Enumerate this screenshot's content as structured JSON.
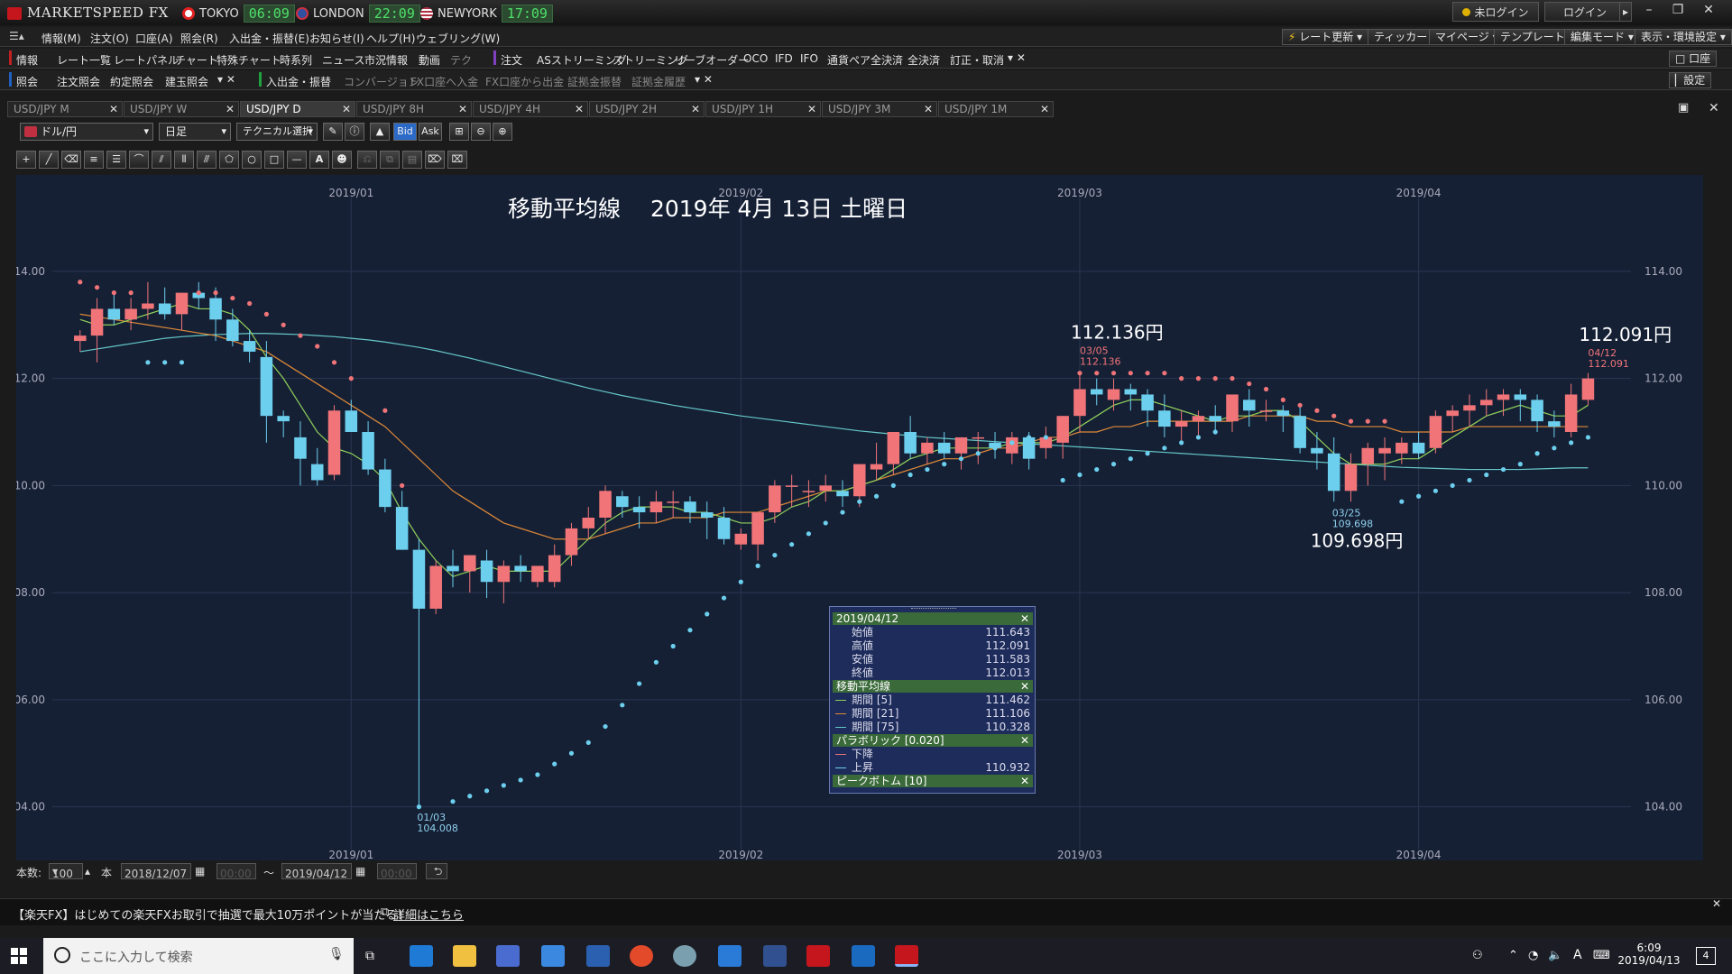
{
  "app": {
    "title": "MARKETSPEED FX",
    "clocks": [
      {
        "city": "TOKYO",
        "time": "06:09",
        "flag_color": "#e02020"
      },
      {
        "city": "LONDON",
        "time": "22:09",
        "flag_color": "#3050a0"
      },
      {
        "city": "NEWYORK",
        "time": "17:09",
        "flag_color": "#b03040"
      }
    ],
    "status_label": "未ログイン",
    "login_label": "ログイン"
  },
  "menu": {
    "items": [
      "情報(M)",
      "注文(O)",
      "口座(A)",
      "照会(R)",
      "入出金・振替(E)",
      "お知らせ(I)",
      "ヘルプ(H)",
      "ウェブリング(W)"
    ],
    "right_buttons": [
      "レート更新",
      "ティッカー",
      "マイページ",
      "テンプレート",
      "編集モード",
      "表示・環境設定"
    ]
  },
  "toolbar1": {
    "info_label": "情報",
    "items": [
      "レート一覧",
      "レートパネル",
      "チャート",
      "特殊チャート",
      "時系列",
      "ニュース",
      "市況情報",
      "動画",
      "テク"
    ],
    "order_label": "注文",
    "order_items": [
      "ASストリーミング",
      "ストリーミング",
      "リーブオーダー",
      "OCO",
      "IFD",
      "IFO",
      "通貨ペア全決済",
      "全決済",
      "訂正・取消"
    ],
    "right_label": "口座"
  },
  "toolbar2": {
    "inquiry_label": "照会",
    "items": [
      "注文照会",
      "約定照会",
      "建玉照会"
    ],
    "deposit_label": "入出金・振替",
    "items2": [
      "コンバージョン",
      "FX口座へ入金",
      "FX口座から出金",
      "証拠金振替",
      "証拠金履歴"
    ],
    "right_label": "設定"
  },
  "tabs": [
    "USD/JPY M",
    "USD/JPY W",
    "USD/JPY D",
    "USD/JPY 8H",
    "USD/JPY 4H",
    "USD/JPY 2H",
    "USD/JPY 1H",
    "USD/JPY 3M",
    "USD/JPY 1M"
  ],
  "active_tab": 2,
  "chart_toolbar": {
    "pair": "ドル/円",
    "period": "日足",
    "technical": "テクニカル選択",
    "bid": "Bid",
    "ask": "Ask"
  },
  "chart_data": {
    "type": "candlestick",
    "title": "移動平均線　 2019年 4月 13日 土曜日",
    "ylim": [
      103.0,
      115.8
    ],
    "yticks": [
      "114.00",
      "112.00",
      "110.00",
      "108.00",
      "106.00",
      "104.00"
    ],
    "x_labels_top": [
      "2019/01",
      "2019/02",
      "2019/03",
      "2019/04"
    ],
    "x_labels_bottom": [
      "2019/01",
      "2019/02",
      "2019/03",
      "2019/04"
    ],
    "annotations": {
      "high1": {
        "big": "112.136円",
        "date": "03/05",
        "value": "112.136"
      },
      "high2": {
        "big": "112.091円",
        "date": "04/12",
        "value": "112.091"
      },
      "low1": {
        "big": "109.698円",
        "date": "03/25",
        "value": "109.698"
      },
      "low2": {
        "date": "01/03",
        "value": "104.008"
      }
    },
    "candles": [
      [
        112.7,
        112.9,
        112.5,
        112.8
      ],
      [
        112.8,
        113.5,
        112.3,
        113.3
      ],
      [
        113.3,
        113.6,
        113.0,
        113.1
      ],
      [
        113.1,
        113.5,
        112.9,
        113.3
      ],
      [
        113.3,
        113.8,
        113.1,
        113.4
      ],
      [
        113.4,
        113.7,
        113.1,
        113.2
      ],
      [
        113.2,
        113.6,
        112.9,
        113.6
      ],
      [
        113.6,
        113.8,
        113.3,
        113.5
      ],
      [
        113.5,
        113.7,
        112.7,
        113.1
      ],
      [
        113.1,
        113.3,
        112.6,
        112.7
      ],
      [
        112.7,
        112.9,
        112.3,
        112.5
      ],
      [
        112.4,
        112.7,
        110.8,
        111.3
      ],
      [
        111.3,
        111.4,
        110.9,
        111.2
      ],
      [
        110.9,
        111.2,
        110.0,
        110.5
      ],
      [
        110.4,
        110.7,
        110.0,
        110.1
      ],
      [
        110.2,
        111.5,
        110.1,
        111.4
      ],
      [
        111.4,
        111.6,
        111.0,
        111.0
      ],
      [
        111.0,
        111.2,
        110.2,
        110.3
      ],
      [
        110.3,
        110.5,
        109.5,
        109.6
      ],
      [
        109.6,
        109.9,
        108.8,
        108.8
      ],
      [
        108.8,
        109.0,
        104.0,
        107.7
      ],
      [
        107.7,
        108.6,
        107.6,
        108.5
      ],
      [
        108.5,
        108.8,
        108.1,
        108.4
      ],
      [
        108.4,
        108.7,
        108.0,
        108.7
      ],
      [
        108.6,
        108.8,
        107.9,
        108.2
      ],
      [
        108.2,
        108.6,
        107.8,
        108.5
      ],
      [
        108.5,
        108.7,
        108.2,
        108.4
      ],
      [
        108.2,
        108.5,
        108.1,
        108.5
      ],
      [
        108.2,
        108.9,
        108.1,
        108.7
      ],
      [
        108.7,
        109.3,
        108.5,
        109.2
      ],
      [
        109.2,
        109.6,
        109.0,
        109.4
      ],
      [
        109.4,
        110.0,
        109.1,
        109.9
      ],
      [
        109.8,
        109.9,
        109.4,
        109.6
      ],
      [
        109.6,
        109.8,
        109.2,
        109.5
      ],
      [
        109.5,
        109.9,
        109.3,
        109.7
      ],
      [
        109.7,
        109.9,
        109.4,
        109.7
      ],
      [
        109.7,
        109.8,
        109.3,
        109.5
      ],
      [
        109.5,
        109.7,
        109.0,
        109.4
      ],
      [
        109.4,
        109.6,
        108.9,
        109.0
      ],
      [
        108.9,
        109.2,
        108.8,
        109.1
      ],
      [
        108.9,
        109.5,
        108.6,
        109.5
      ],
      [
        109.5,
        110.1,
        109.3,
        110.0
      ],
      [
        110.0,
        110.2,
        109.6,
        110.0
      ],
      [
        109.9,
        110.1,
        109.6,
        109.9
      ],
      [
        109.9,
        110.2,
        109.7,
        110.0
      ],
      [
        109.9,
        110.1,
        109.6,
        109.8
      ],
      [
        109.8,
        110.4,
        109.6,
        110.4
      ],
      [
        110.3,
        110.8,
        110.1,
        110.4
      ],
      [
        110.4,
        111.0,
        110.2,
        111.0
      ],
      [
        111.0,
        111.3,
        110.5,
        110.6
      ],
      [
        110.6,
        110.9,
        110.4,
        110.8
      ],
      [
        110.8,
        111.0,
        110.5,
        110.6
      ],
      [
        110.6,
        110.9,
        110.3,
        110.9
      ],
      [
        110.9,
        111.0,
        110.4,
        110.9
      ],
      [
        110.8,
        111.0,
        110.5,
        110.7
      ],
      [
        110.6,
        111.0,
        110.4,
        110.9
      ],
      [
        110.9,
        111.0,
        110.3,
        110.5
      ],
      [
        110.7,
        111.1,
        110.5,
        110.9
      ],
      [
        110.8,
        111.3,
        110.5,
        111.3
      ],
      [
        111.3,
        112.1,
        111.0,
        111.8
      ],
      [
        111.8,
        112.0,
        111.5,
        111.7
      ],
      [
        111.6,
        112.0,
        111.4,
        111.8
      ],
      [
        111.8,
        111.9,
        111.4,
        111.7
      ],
      [
        111.7,
        111.8,
        111.1,
        111.4
      ],
      [
        111.4,
        111.7,
        110.9,
        111.1
      ],
      [
        111.1,
        111.4,
        110.8,
        111.2
      ],
      [
        111.2,
        111.4,
        110.9,
        111.3
      ],
      [
        111.3,
        111.5,
        111.0,
        111.2
      ],
      [
        111.2,
        111.7,
        111.0,
        111.7
      ],
      [
        111.6,
        111.8,
        111.1,
        111.4
      ],
      [
        111.4,
        111.6,
        111.2,
        111.4
      ],
      [
        111.4,
        111.5,
        111.0,
        111.3
      ],
      [
        111.3,
        111.5,
        110.6,
        110.7
      ],
      [
        110.7,
        111.0,
        110.3,
        110.6
      ],
      [
        110.6,
        110.9,
        109.7,
        109.9
      ],
      [
        109.9,
        110.6,
        109.7,
        110.4
      ],
      [
        110.4,
        110.8,
        110.0,
        110.7
      ],
      [
        110.6,
        110.9,
        110.1,
        110.7
      ],
      [
        110.6,
        110.9,
        110.4,
        110.8
      ],
      [
        110.8,
        111.0,
        110.5,
        110.6
      ],
      [
        110.7,
        111.4,
        110.6,
        111.3
      ],
      [
        111.3,
        111.5,
        111.0,
        111.4
      ],
      [
        111.4,
        111.7,
        111.1,
        111.5
      ],
      [
        111.5,
        111.8,
        111.3,
        111.6
      ],
      [
        111.6,
        111.8,
        111.3,
        111.7
      ],
      [
        111.7,
        111.8,
        111.2,
        111.6
      ],
      [
        111.6,
        111.7,
        111.0,
        111.2
      ],
      [
        111.2,
        111.4,
        110.9,
        111.1
      ],
      [
        111.0,
        111.9,
        110.9,
        111.7
      ],
      [
        111.6,
        112.1,
        111.5,
        112.0
      ]
    ],
    "ma5": [
      113.1,
      113.0,
      113.0,
      113.1,
      113.2,
      113.3,
      113.4,
      113.3,
      113.3,
      113.2,
      112.9,
      112.4,
      112.0,
      111.5,
      111.0,
      110.7,
      110.6,
      110.4,
      110.1,
      109.5,
      109.0,
      108.6,
      108.3,
      108.4,
      108.5,
      108.4,
      108.4,
      108.4,
      108.4,
      108.7,
      109.0,
      109.3,
      109.5,
      109.6,
      109.6,
      109.6,
      109.5,
      109.5,
      109.4,
      109.3,
      109.3,
      109.4,
      109.6,
      109.7,
      109.9,
      109.9,
      110.0,
      110.1,
      110.3,
      110.5,
      110.6,
      110.7,
      110.7,
      110.7,
      110.7,
      110.8,
      110.8,
      110.8,
      110.9,
      111.1,
      111.3,
      111.5,
      111.6,
      111.6,
      111.5,
      111.4,
      111.3,
      111.2,
      111.3,
      111.3,
      111.4,
      111.4,
      111.2,
      110.9,
      110.6,
      110.4,
      110.4,
      110.4,
      110.5,
      110.5,
      110.7,
      110.9,
      111.1,
      111.3,
      111.4,
      111.5,
      111.4,
      111.3,
      111.3,
      111.5
    ],
    "ma21": [
      113.2,
      113.15,
      113.1,
      113.05,
      113.0,
      112.95,
      112.9,
      112.85,
      112.8,
      112.7,
      112.6,
      112.5,
      112.3,
      112.1,
      111.9,
      111.7,
      111.5,
      111.3,
      111.1,
      110.8,
      110.5,
      110.2,
      109.9,
      109.7,
      109.5,
      109.3,
      109.2,
      109.1,
      109.0,
      109.0,
      109.0,
      109.1,
      109.2,
      109.3,
      109.3,
      109.4,
      109.4,
      109.4,
      109.5,
      109.5,
      109.5,
      109.6,
      109.7,
      109.8,
      109.9,
      109.9,
      110.0,
      110.1,
      110.2,
      110.3,
      110.4,
      110.5,
      110.5,
      110.6,
      110.7,
      110.7,
      110.8,
      110.9,
      110.9,
      111.0,
      111.0,
      111.1,
      111.1,
      111.2,
      111.2,
      111.2,
      111.2,
      111.2,
      111.2,
      111.3,
      111.3,
      111.3,
      111.3,
      111.2,
      111.2,
      111.1,
      111.1,
      111.1,
      111.0,
      111.0,
      111.0,
      111.0,
      111.1,
      111.1,
      111.1,
      111.1,
      111.1,
      111.1,
      111.1,
      111.1
    ],
    "ma75": [
      112.5,
      112.55,
      112.6,
      112.65,
      112.7,
      112.75,
      112.78,
      112.8,
      112.82,
      112.83,
      112.84,
      112.84,
      112.83,
      112.82,
      112.8,
      112.78,
      112.75,
      112.72,
      112.68,
      112.63,
      112.58,
      112.52,
      112.45,
      112.38,
      112.3,
      112.22,
      112.14,
      112.06,
      111.98,
      111.9,
      111.82,
      111.75,
      111.68,
      111.62,
      111.56,
      111.5,
      111.45,
      111.4,
      111.35,
      111.3,
      111.26,
      111.22,
      111.18,
      111.14,
      111.1,
      111.06,
      111.02,
      110.99,
      110.96,
      110.93,
      110.9,
      110.88,
      110.86,
      110.84,
      110.82,
      110.8,
      110.78,
      110.76,
      110.74,
      110.72,
      110.7,
      110.68,
      110.66,
      110.64,
      110.62,
      110.6,
      110.58,
      110.56,
      110.54,
      110.52,
      110.5,
      110.48,
      110.46,
      110.44,
      110.42,
      110.4,
      110.38,
      110.36,
      110.34,
      110.33,
      110.32,
      110.31,
      110.3,
      110.3,
      110.3,
      110.3,
      110.31,
      110.32,
      110.33,
      110.33
    ],
    "psar_down": [
      [
        0,
        113.8
      ],
      [
        1,
        113.7
      ],
      [
        2,
        113.6
      ],
      [
        3,
        113.6
      ],
      [
        7,
        113.6
      ],
      [
        8,
        113.6
      ],
      [
        9,
        113.5
      ],
      [
        10,
        113.4
      ],
      [
        11,
        113.2
      ],
      [
        12,
        113.0
      ],
      [
        13,
        112.8
      ],
      [
        14,
        112.6
      ],
      [
        15,
        112.3
      ],
      [
        16,
        112.0
      ],
      [
        18,
        111.4
      ],
      [
        19,
        110.0
      ],
      [
        58,
        111.2
      ],
      [
        59,
        112.1
      ],
      [
        60,
        112.1
      ],
      [
        61,
        112.1
      ],
      [
        62,
        112.1
      ],
      [
        63,
        112.1
      ],
      [
        64,
        112.1
      ],
      [
        65,
        112.0
      ],
      [
        66,
        112.0
      ],
      [
        67,
        112.0
      ],
      [
        68,
        112.0
      ],
      [
        69,
        111.9
      ],
      [
        70,
        111.8
      ],
      [
        71,
        111.6
      ],
      [
        72,
        111.5
      ],
      [
        73,
        111.4
      ],
      [
        74,
        111.3
      ],
      [
        75,
        111.2
      ],
      [
        76,
        111.2
      ],
      [
        77,
        111.2
      ]
    ],
    "psar_up": [
      [
        4,
        112.3
      ],
      [
        5,
        112.3
      ],
      [
        6,
        112.3
      ],
      [
        20,
        104.0
      ],
      [
        22,
        104.1
      ],
      [
        23,
        104.2
      ],
      [
        24,
        104.3
      ],
      [
        25,
        104.4
      ],
      [
        26,
        104.5
      ],
      [
        27,
        104.6
      ],
      [
        28,
        104.8
      ],
      [
        29,
        105.0
      ],
      [
        30,
        105.2
      ],
      [
        31,
        105.5
      ],
      [
        32,
        105.9
      ],
      [
        33,
        106.3
      ],
      [
        34,
        106.7
      ],
      [
        35,
        107.0
      ],
      [
        36,
        107.3
      ],
      [
        37,
        107.6
      ],
      [
        38,
        107.9
      ],
      [
        39,
        108.2
      ],
      [
        40,
        108.5
      ],
      [
        41,
        108.7
      ],
      [
        42,
        108.9
      ],
      [
        43,
        109.1
      ],
      [
        44,
        109.3
      ],
      [
        45,
        109.5
      ],
      [
        46,
        109.7
      ],
      [
        47,
        109.8
      ],
      [
        48,
        110.0
      ],
      [
        49,
        110.2
      ],
      [
        50,
        110.3
      ],
      [
        51,
        110.4
      ],
      [
        52,
        110.5
      ],
      [
        53,
        110.6
      ],
      [
        54,
        110.7
      ],
      [
        55,
        110.8
      ],
      [
        56,
        110.9
      ],
      [
        57,
        110.9
      ],
      [
        58,
        110.1
      ],
      [
        59,
        110.2
      ],
      [
        60,
        110.3
      ],
      [
        61,
        110.4
      ],
      [
        62,
        110.5
      ],
      [
        63,
        110.6
      ],
      [
        64,
        110.7
      ],
      [
        65,
        110.8
      ],
      [
        66,
        110.9
      ],
      [
        67,
        111.0
      ],
      [
        78,
        109.7
      ],
      [
        79,
        109.8
      ],
      [
        80,
        109.9
      ],
      [
        81,
        110.0
      ],
      [
        82,
        110.1
      ],
      [
        83,
        110.2
      ],
      [
        84,
        110.3
      ],
      [
        85,
        110.4
      ],
      [
        86,
        110.6
      ],
      [
        87,
        110.7
      ],
      [
        88,
        110.8
      ],
      [
        89,
        110.9
      ]
    ],
    "colors": {
      "up": "#f07478",
      "down": "#6ccfee",
      "ma5": "#8fcf5a",
      "ma21": "#e08a38",
      "ma75": "#66c8c8",
      "psar_down": "#f07478",
      "psar_up": "#6ccfee",
      "grid": "#2a3650",
      "background": "#152035"
    }
  },
  "info_panel": {
    "date": "2019/04/12",
    "ohlc": [
      {
        "label": "始値",
        "value": "111.643"
      },
      {
        "label": "高値",
        "value": "112.091"
      },
      {
        "label": "安値",
        "value": "111.583"
      },
      {
        "label": "終値",
        "value": "112.013"
      }
    ],
    "ma_title": "移動平均線",
    "ma_rows": [
      {
        "label": "期間 [5]",
        "value": "111.462",
        "color": "#8fcf5a"
      },
      {
        "label": "期間 [21]",
        "value": "111.106",
        "color": "#e08a38"
      },
      {
        "label": "期間 [75]",
        "value": "110.328",
        "color": "#66c8c8"
      }
    ],
    "psar_title": "パラボリック [0.020]",
    "psar_rows": [
      {
        "label": "下降",
        "value": "",
        "color": "#f07478"
      },
      {
        "label": "上昇",
        "value": "110.932",
        "color": "#6ccfee"
      }
    ],
    "peak_title": "ピークボトム [10]"
  },
  "bottom_bar": {
    "count_label": "本数:",
    "count_value": "100",
    "unit": "本",
    "from_date": "2018/12/07",
    "from_time": "00:00",
    "tilde": "〜",
    "to_date": "2019/04/12",
    "to_time": "00:00"
  },
  "news": {
    "text": "【楽天FX】はじめての楽天FXお取引で抽選で最大10万ポイントが当たる！",
    "link": "詳細はこちら"
  },
  "taskbar": {
    "search_placeholder": "ここに入力して検索",
    "time": "6:09",
    "date": "2019/04/13",
    "ime": "A",
    "notif_count": "4"
  }
}
